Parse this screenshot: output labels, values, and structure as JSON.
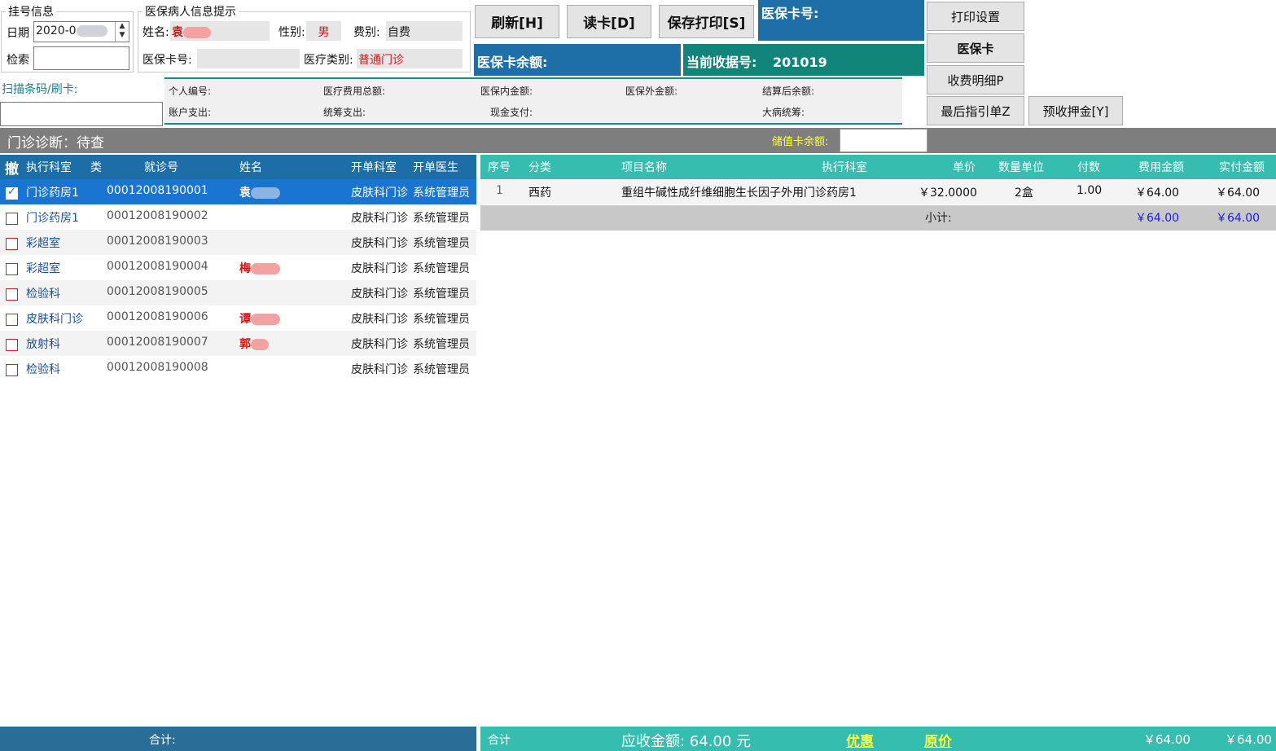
{
  "reg_info": {
    "legend": "挂号信息",
    "date_label": "日期",
    "date_value": "2020-0",
    "search_label": "检索",
    "search_value": ""
  },
  "patient_info": {
    "legend": "医保病人信息提示",
    "name_label": "姓名:",
    "name_value": "袁",
    "gender_label": "性别:",
    "gender_value": "男",
    "fee_type_label": "费别:",
    "fee_type_value": "自费",
    "card_no_label": "医保卡号:",
    "card_no_value": "",
    "medical_type_label": "医疗类别:",
    "medical_type_value": "普通门诊"
  },
  "toolbar": {
    "refresh": "刷新[H]",
    "read_card": "读卡[D]",
    "save_print": "保存打印[S]"
  },
  "card_panel": {
    "card_no_label": "医保卡号:",
    "balance_label": "医保卡余额:",
    "receipt_label": "当前收据号:",
    "receipt_value": "201019"
  },
  "side_buttons": {
    "print_settings": "打印设置",
    "insurance_card": "医保卡",
    "charge_detail": "收费明细P",
    "last_guide": "最后指引单Z",
    "deposit": "预收押金[Y]"
  },
  "scan": {
    "label": "扫描条码/刷卡:",
    "value": ""
  },
  "settlement": {
    "personal_no": "个人编号:",
    "total_cost": "医疗费用总额:",
    "in_insurance": "医保内金额:",
    "out_insurance": "医保外金额:",
    "balance_after": "结算后余额:",
    "account_pay": "账户支出:",
    "pooled_pay": "统筹支出:",
    "cash_pay": "现金支付:",
    "serious_pool": "大病统筹:"
  },
  "diagnosis_bar": {
    "label": "门诊诊断：待查",
    "stored_card_label": "储值卡余额:",
    "stored_card_value": ""
  },
  "visit_table": {
    "headers": [
      "撤",
      "执行科室",
      "类",
      "就诊号",
      "姓名",
      "开单科室",
      "开单医生"
    ],
    "rows": [
      {
        "dept": "门诊药房1",
        "visit_no": "00012008190001",
        "name": "袁",
        "order_dept": "皮肤科门诊",
        "doctor": "系统管理员",
        "checked": true
      },
      {
        "dept": "门诊药房1",
        "visit_no": "00012008190002",
        "name": "",
        "order_dept": "皮肤科门诊",
        "doctor": "系统管理员",
        "checked": false
      },
      {
        "dept": "彩超室",
        "visit_no": "00012008190003",
        "name": "",
        "order_dept": "皮肤科门诊",
        "doctor": "系统管理员",
        "checked": false
      },
      {
        "dept": "彩超室",
        "visit_no": "00012008190004",
        "name": "梅",
        "order_dept": "皮肤科门诊",
        "doctor": "系统管理员",
        "checked": false
      },
      {
        "dept": "检验科",
        "visit_no": "00012008190005",
        "name": "",
        "order_dept": "皮肤科门诊",
        "doctor": "系统管理员",
        "checked": false
      },
      {
        "dept": "皮肤科门诊",
        "visit_no": "00012008190006",
        "name": "谭",
        "order_dept": "皮肤科门诊",
        "doctor": "系统管理员",
        "checked": false
      },
      {
        "dept": "放射科",
        "visit_no": "00012008190007",
        "name": "郭",
        "order_dept": "皮肤科门诊",
        "doctor": "系统管理员",
        "checked": false
      },
      {
        "dept": "检验科",
        "visit_no": "00012008190008",
        "name": "",
        "order_dept": "皮肤科门诊",
        "doctor": "系统管理员",
        "checked": false
      }
    ]
  },
  "item_table": {
    "headers": [
      "序号",
      "分类",
      "项目名称",
      "执行科室",
      "单价",
      "数量单位",
      "付数",
      "费用金额",
      "实付金额"
    ],
    "rows": [
      {
        "seq": "1",
        "category": "西药",
        "item": "重组牛碱性成纤维细胞生长因子外用门诊药房1",
        "unit_price": "￥32.0000",
        "qty": "2盒",
        "doses": "1.00",
        "amount": "￥64.00",
        "paid": "￥64.00"
      }
    ],
    "subtotal_label": "小计:",
    "subtotal_amount": "￥64.00",
    "subtotal_paid": "￥64.00"
  },
  "footer": {
    "left_total_label": "合计:",
    "right_total_label": "合计",
    "receivable": "应收金额: 64.00 元",
    "discount": "优惠",
    "original": "原价",
    "amount": "￥64.00",
    "paid": "￥64.00"
  },
  "colors": {
    "header_blue": "#1d6ea7",
    "teal": "#35bdb0",
    "dark_teal": "#12857a",
    "alert_red": "#e01010"
  }
}
